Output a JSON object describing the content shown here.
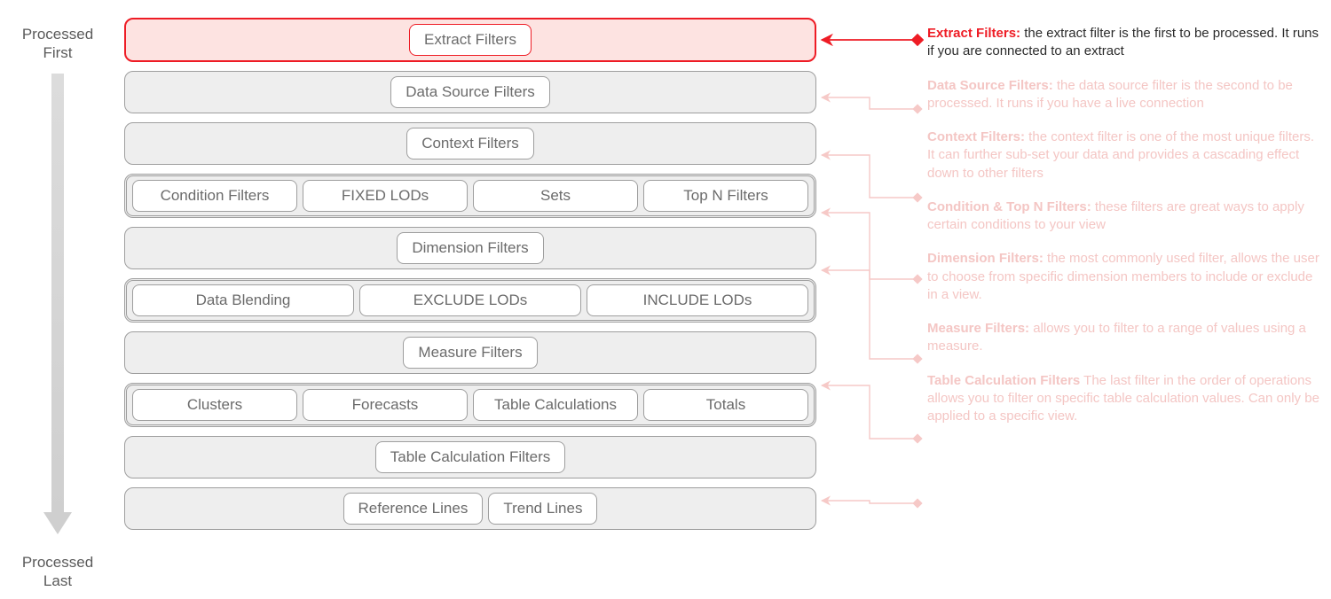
{
  "axis": {
    "top": "Processed\nFirst",
    "bottom": "Processed\nLast"
  },
  "rows": [
    {
      "id": "extract",
      "highlighted": true,
      "grouped": false,
      "pills": [
        "Extract Filters"
      ]
    },
    {
      "id": "datasource",
      "highlighted": false,
      "grouped": false,
      "pills": [
        "Data Source Filters"
      ]
    },
    {
      "id": "context",
      "highlighted": false,
      "grouped": false,
      "pills": [
        "Context Filters"
      ]
    },
    {
      "id": "cond",
      "highlighted": false,
      "grouped": true,
      "pills": [
        "Condition Filters",
        "FIXED LODs",
        "Sets",
        "Top N Filters"
      ]
    },
    {
      "id": "dimension",
      "highlighted": false,
      "grouped": false,
      "pills": [
        "Dimension Filters"
      ]
    },
    {
      "id": "blend",
      "highlighted": false,
      "grouped": true,
      "pills": [
        "Data Blending",
        "EXCLUDE LODs",
        "INCLUDE LODs"
      ]
    },
    {
      "id": "measure",
      "highlighted": false,
      "grouped": false,
      "pills": [
        "Measure Filters"
      ]
    },
    {
      "id": "clusters",
      "highlighted": false,
      "grouped": true,
      "pills": [
        "Clusters",
        "Forecasts",
        "Table Calculations",
        "Totals"
      ]
    },
    {
      "id": "tablecalc",
      "highlighted": false,
      "grouped": false,
      "pills": [
        "Table Calculation Filters"
      ]
    },
    {
      "id": "ref",
      "highlighted": false,
      "grouped": false,
      "pills": [
        "Reference Lines",
        "Trend Lines"
      ]
    }
  ],
  "notes": [
    {
      "title": "Extract Filters:",
      "body": " the extract filter is the first to be processed. It runs if you are connected to an extract",
      "active": true
    },
    {
      "title": "Data Source Filters:",
      "body": " the data source filter is the second to be processed. It runs if you have a live connection",
      "active": false
    },
    {
      "title": "Context Filters:",
      "body": " the context filter is one of the most unique filters. It can further sub-set your data and provides a cascading effect down to other filters",
      "active": false
    },
    {
      "title": "Condition & Top N Filters:",
      "body": " these filters are great ways to apply certain conditions to your view",
      "active": false
    },
    {
      "title": "Dimension Filters:",
      "body": " the most commonly used filter, allows the user to choose from specific dimension members to include or exclude in a view.",
      "active": false
    },
    {
      "title": "Measure Filters:",
      "body": "  allows you to filter to a range of values using a measure.",
      "active": false
    },
    {
      "title": "Table Calculation Filters",
      "body": " The last filter in the order of operations allows you to filter on specific table calculation values. Can only be applied to a specific view.",
      "active": false
    }
  ],
  "connectors": [
    {
      "fromY": 45,
      "toY": 45,
      "active": true
    },
    {
      "fromY": 110,
      "toY": 123,
      "active": false
    },
    {
      "fromY": 175,
      "toY": 223,
      "active": false
    },
    {
      "fromY": 240,
      "toY": 315,
      "active": false
    },
    {
      "fromY": 305,
      "toY": 405,
      "active": false
    },
    {
      "fromY": 435,
      "toY": 495,
      "active": false
    },
    {
      "fromY": 565,
      "toY": 568,
      "active": false
    }
  ]
}
